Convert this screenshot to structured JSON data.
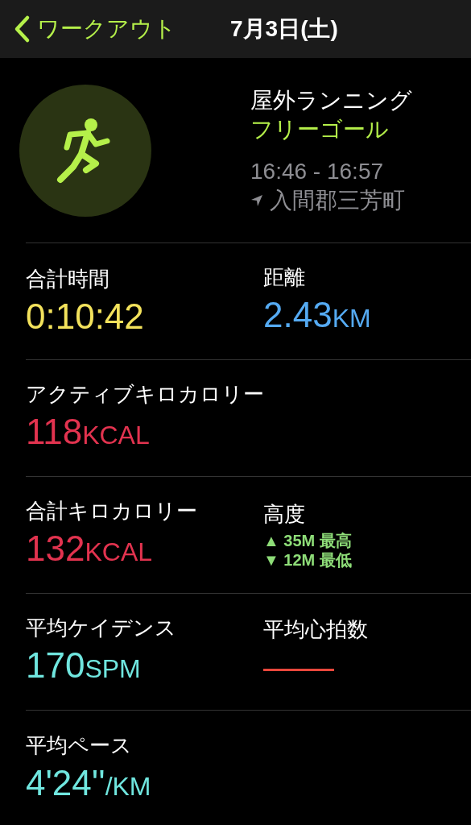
{
  "nav": {
    "back_label": "ワークアウト",
    "title": "7月3日(土)"
  },
  "summary": {
    "activity": "屋外ランニング",
    "goal": "フリーゴール",
    "time": "16:46 - 16:57",
    "location": "入間郡三芳町"
  },
  "rows": [
    [
      {
        "kind": "value",
        "label": "合計時間",
        "value": "0:10:42",
        "color": "#f3e25c"
      },
      {
        "kind": "value",
        "label": "距離",
        "value": "2.43",
        "unit": "KM",
        "color": "#55aaf2"
      }
    ],
    [
      {
        "kind": "value",
        "label": "アクティブキロカロリー",
        "value": "118",
        "unit": "KCAL",
        "color": "#e2334f"
      }
    ],
    [
      {
        "kind": "value",
        "label": "合計キロカロリー",
        "value": "132",
        "unit": "KCAL",
        "color": "#e2334f"
      },
      {
        "kind": "elevation",
        "label": "高度",
        "color": "#8edd78",
        "lines": [
          {
            "marker": "▲",
            "value": "35M",
            "caption": "最高"
          },
          {
            "marker": "▼",
            "value": "12M",
            "caption": "最低"
          }
        ]
      }
    ],
    [
      {
        "kind": "value",
        "label": "平均ケイデンス",
        "value": "170",
        "unit": "SPM",
        "color": "#70e6df"
      },
      {
        "kind": "value",
        "label": "平均心拍数",
        "value": "——",
        "color": "#e8473c"
      }
    ],
    [
      {
        "kind": "value",
        "label": "平均ペース",
        "value": "4'24''",
        "unit": "/KM",
        "color": "#70e6df"
      }
    ]
  ]
}
